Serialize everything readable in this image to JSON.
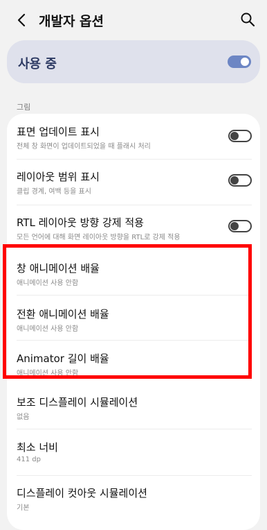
{
  "header": {
    "title": "개발자 옵션"
  },
  "master": {
    "label": "사용 중",
    "enabled": true
  },
  "section": {
    "header": "그림"
  },
  "rows": [
    {
      "title": "표면 업데이트 표시",
      "subtitle": "전체 창 화면이 업데이트되었을 때 플래시 처리",
      "toggle": false
    },
    {
      "title": "레이아웃 범위 표시",
      "subtitle": "클립 경계, 여백 등을 표시",
      "toggle": false
    },
    {
      "title": "RTL 레이아웃 방향 강제 적용",
      "subtitle": "모든 언어에 대해 화면 레이아웃 방향을 RTL로 강제 적용",
      "toggle": false
    },
    {
      "title": "창 애니메이션 배율",
      "subtitle": "애니메이션 사용 안함"
    },
    {
      "title": "전환 애니메이션 배율",
      "subtitle": "애니메이션 사용 안함"
    },
    {
      "title": "Animator 길이 배율",
      "subtitle": "애니메이션 사용 안함"
    },
    {
      "title": "보조 디스플레이 시뮬레이션",
      "subtitle": "없음"
    },
    {
      "title": "최소 너비",
      "subtitle": "411 dp"
    },
    {
      "title": "디스플레이 컷아웃 시뮬레이션",
      "subtitle": "기본"
    }
  ],
  "colors": {
    "highlight": "#ff0000",
    "accent": "#6d86c4",
    "master_bg": "#dfe1ec"
  }
}
